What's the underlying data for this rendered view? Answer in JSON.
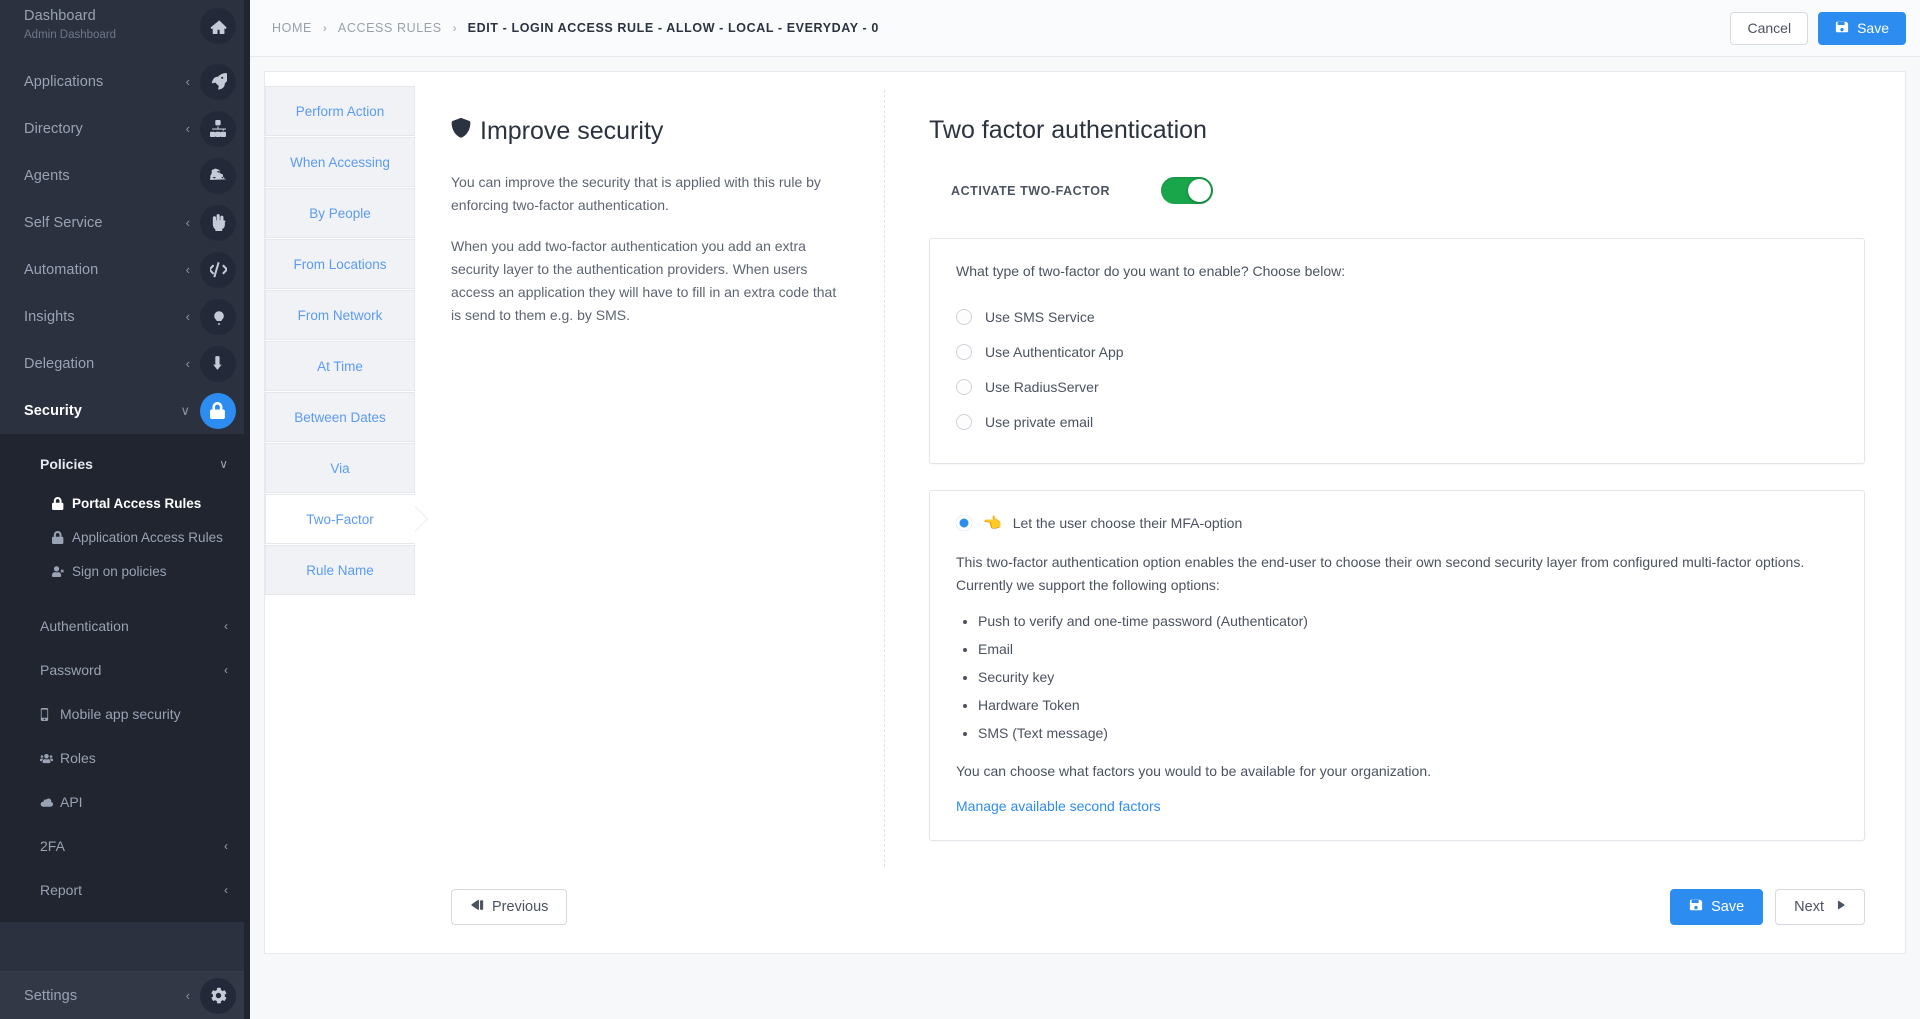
{
  "sidebar": {
    "primary": [
      {
        "label": "Dashboard",
        "sublabel": "Admin Dashboard",
        "icon": "home-icon",
        "chevron": "",
        "active": false
      },
      {
        "label": "Applications",
        "sublabel": "",
        "icon": "rocket-icon",
        "chevron": "‹",
        "active": false
      },
      {
        "label": "Directory",
        "sublabel": "",
        "icon": "sitemap-icon",
        "chevron": "‹",
        "active": false
      },
      {
        "label": "Agents",
        "sublabel": "",
        "icon": "cubes-icon",
        "chevron": "",
        "active": false
      },
      {
        "label": "Self Service",
        "sublabel": "",
        "icon": "hand-pointer-icon",
        "chevron": "‹",
        "active": false
      },
      {
        "label": "Automation",
        "sublabel": "",
        "icon": "code-icon",
        "chevron": "‹",
        "active": false
      },
      {
        "label": "Insights",
        "sublabel": "",
        "icon": "lightbulb-icon",
        "chevron": "‹",
        "active": false
      },
      {
        "label": "Delegation",
        "sublabel": "",
        "icon": "arrow-turn-down-icon",
        "chevron": "‹",
        "active": false
      },
      {
        "label": "Security",
        "sublabel": "",
        "icon": "lock-icon",
        "chevron": "∨",
        "active": true
      }
    ],
    "policies_section": {
      "label": "Policies",
      "chevron": "∨"
    },
    "policy_items": [
      {
        "label": "Portal Access Rules",
        "icon": "lock-icon",
        "selected": true
      },
      {
        "label": "Application Access Rules",
        "icon": "lock-icon",
        "selected": false
      },
      {
        "label": "Sign on policies",
        "icon": "user-times-icon",
        "selected": false
      }
    ],
    "sub_sections": [
      {
        "label": "Authentication",
        "chevron": "‹",
        "icon": ""
      },
      {
        "label": "Password",
        "chevron": "‹",
        "icon": ""
      }
    ],
    "sub_items": [
      {
        "label": "Mobile app security",
        "icon": "mobile-icon"
      },
      {
        "label": "Roles",
        "icon": "users-icon"
      },
      {
        "label": "API",
        "icon": "cloud-icon"
      }
    ],
    "tail_sections": [
      {
        "label": "2FA",
        "chevron": "‹"
      },
      {
        "label": "Report",
        "chevron": "‹"
      }
    ],
    "settings": {
      "label": "Settings",
      "chevron": "‹",
      "icon": "gear-icon"
    }
  },
  "topbar": {
    "breadcrumb": [
      {
        "label": "HOME",
        "current": false
      },
      {
        "label": "ACCESS RULES",
        "current": false
      },
      {
        "label": "EDIT - LOGIN ACCESS RULE - ALLOW - LOCAL - EVERYDAY - 0",
        "current": true
      }
    ],
    "separator": "›",
    "cancel_label": "Cancel",
    "save_label": "Save"
  },
  "steps": [
    {
      "label": "Perform Action",
      "active": false
    },
    {
      "label": "When Accessing",
      "active": false
    },
    {
      "label": "By People",
      "active": false
    },
    {
      "label": "From Locations",
      "active": false
    },
    {
      "label": "From Network",
      "active": false
    },
    {
      "label": "At Time",
      "active": false
    },
    {
      "label": "Between Dates",
      "active": false
    },
    {
      "label": "Via",
      "active": false
    },
    {
      "label": "Two-Factor",
      "active": true
    },
    {
      "label": "Rule Name",
      "active": false
    }
  ],
  "left_pane": {
    "title": "Improve security",
    "title_icon": "shield-icon",
    "paragraph1": "You can improve the security that is applied with this rule by enforcing two-factor authentication.",
    "paragraph2": "When you add two-factor authentication you add an extra security layer to the authentication providers. When users access an application they will have to fill in an extra code that is send to them e.g. by SMS."
  },
  "right_pane": {
    "title": "Two factor authentication",
    "activate_label": "ACTIVATE TWO-FACTOR",
    "activate_on": true,
    "type_question": "What type of two-factor do you want to enable? Choose below:",
    "type_options": [
      {
        "label": "Use SMS Service",
        "checked": false
      },
      {
        "label": "Use Authenticator App",
        "checked": false
      },
      {
        "label": "Use RadiusServer",
        "checked": false
      },
      {
        "label": "Use private email",
        "checked": false
      }
    ],
    "mfa": {
      "label": "Let the user choose their MFA-option",
      "icon": "hand-pointer-icon",
      "checked": true,
      "description": "This two-factor authentication option enables the end-user to choose their own second security layer from configured multi-factor options. Currently we support the following options:",
      "options": [
        "Push to verify and one-time password (Authenticator)",
        "Email",
        "Security key",
        "Hardware Token",
        "SMS (Text message)"
      ],
      "note": "You can choose what factors you would to be available for your organization.",
      "link": "Manage available second factors"
    }
  },
  "footer": {
    "previous_label": "Previous",
    "save_label": "Save",
    "next_label": "Next"
  },
  "colors": {
    "accent": "#2d8cf0",
    "toggle_on": "#19a64a",
    "sidebar_bg": "#2b313f",
    "submenu_bg": "#20252f",
    "link": "#2d8cf0",
    "step_text": "#5b9bf3"
  }
}
